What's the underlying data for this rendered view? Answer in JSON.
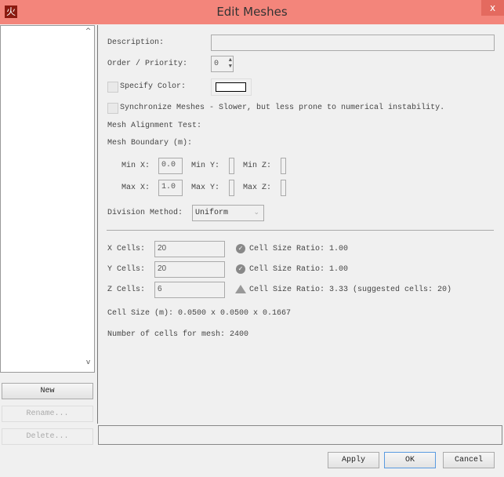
{
  "window": {
    "title": "Edit Meshes",
    "icon": "fds-fire-icon",
    "close": "x"
  },
  "sidebar": {
    "new": "New",
    "rename": "Rename...",
    "delete": "Delete...",
    "scroll_up": "^",
    "scroll_down": "v"
  },
  "form": {
    "description_label": "Description:",
    "description_value": "",
    "priority_label": "Order / Priority:",
    "priority_value": "0",
    "specify_color_label": "Specify Color:",
    "sync_label": "Synchronize Meshes - Slower, but less prone to numerical instability.",
    "alignment_label": "Mesh Alignment Test:",
    "boundary_label": "Mesh Boundary (m):",
    "min_x_label": "Min X:",
    "min_x": "0.0",
    "min_y_label": "Min Y:",
    "min_y": "",
    "min_z_label": "Min Z:",
    "min_z": "",
    "max_x_label": "Max X:",
    "max_x": "1.0",
    "max_y_label": "Max Y:",
    "max_y": "",
    "max_z_label": "Max Z:",
    "max_z": "",
    "division_label": "Division Method:",
    "division_value": "Uniform",
    "x_cells_label": "X Cells:",
    "x_cells": "20",
    "x_ratio": "Cell Size Ratio: 1.00",
    "y_cells_label": "Y Cells:",
    "y_cells": "20",
    "y_ratio": "Cell Size Ratio: 1.00",
    "z_cells_label": "Z Cells:",
    "z_cells": "6",
    "z_ratio": "Cell Size Ratio: 3.33 (suggested cells: 20)",
    "cell_size": "Cell Size (m): 0.0500 x 0.0500 x 0.1667",
    "num_cells": "Number of cells for mesh: 2400"
  },
  "footer": {
    "apply": "Apply",
    "ok": "OK",
    "cancel": "Cancel"
  },
  "colors": {
    "titlebar": "#f3857b"
  }
}
